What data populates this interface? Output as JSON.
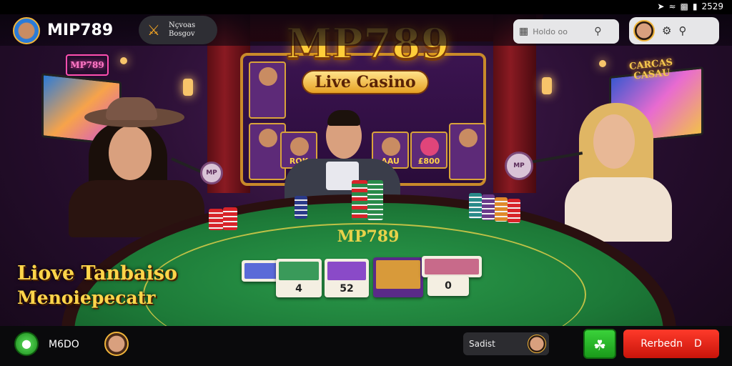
{
  "status_bar": {
    "time": "2529",
    "icons": [
      "gps-icon",
      "wifi-icon",
      "signal-icon",
      "battery-icon"
    ]
  },
  "header": {
    "app_title": "MIP789",
    "promo_chip_line1": "Nçvoas",
    "promo_chip_line2": "Bosgov",
    "search_placeholder": "Holdo oo",
    "icons": {
      "menu": "menu-icon",
      "search": "search-icon",
      "settings": "settings-icon",
      "zoom": "zoom-icon"
    }
  },
  "scene": {
    "brand_logo": "MP789",
    "brand_subtitle": "Live Casino",
    "neon_left": "MP789",
    "neon_right_line1": "CARCAS",
    "neon_right_line2": "CASAU",
    "slot_labels": [
      "ROK",
      "AAU",
      "£800"
    ],
    "felt_logo": "MP789",
    "paddle_left": "MP",
    "paddle_right": "MP"
  },
  "cards": [
    {
      "value": ""
    },
    {
      "value": "4"
    },
    {
      "value": "52"
    },
    {
      "value": ""
    },
    {
      "value": "0"
    }
  ],
  "promo_text": {
    "line1": "Liove Tanbaiso",
    "line2": "Menoiepecatr"
  },
  "footer": {
    "balance_label": "M6DO",
    "chat_placeholder": "Sadist",
    "rebet_label": "Rerbedn",
    "rebet_icon": "D"
  },
  "colors": {
    "gold": "#ffd54a",
    "felt": "#1d7a38",
    "rebet_button": "#e8200f",
    "gift_button": "#2ab82a"
  }
}
